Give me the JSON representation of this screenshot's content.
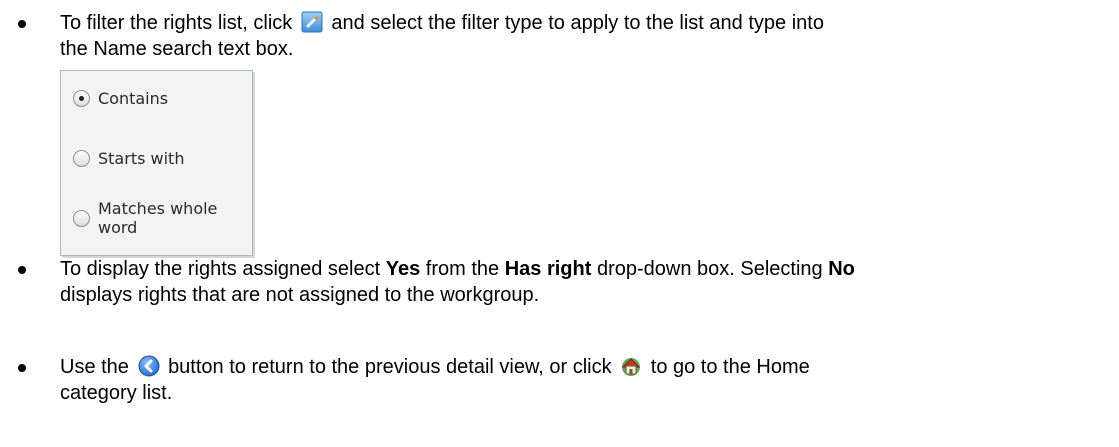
{
  "bullets": [
    {
      "line1_a": "To filter the rights list, click",
      "line1_b": "and select the filter type to apply to the list and type into",
      "line2": "the Name search text box.",
      "filter_icon": "filter-icon"
    },
    {
      "p1": "To display the rights assigned select ",
      "b1": "Yes",
      "p2": " from the ",
      "b2": "Has right",
      "p3": " drop-down box. Selecting ",
      "b3": "No",
      "line2": "displays rights that are not assigned to the workgroup."
    },
    {
      "p1": "Use the",
      "back_icon": "back-arrow-icon",
      "p2": "button to return to the previous detail view, or click",
      "home_icon": "home-icon",
      "p3": "to go to the Home",
      "line2": "category list."
    }
  ],
  "filter_options": [
    {
      "label": "Contains",
      "selected": true
    },
    {
      "label": "Starts with",
      "selected": false
    },
    {
      "label": "Matches whole word",
      "selected": false
    }
  ],
  "colors": {
    "text": "#000000",
    "panel_bg": "#f3f3f3",
    "panel_border": "#aeb6bf",
    "back_icon": "#3a7fd4"
  }
}
